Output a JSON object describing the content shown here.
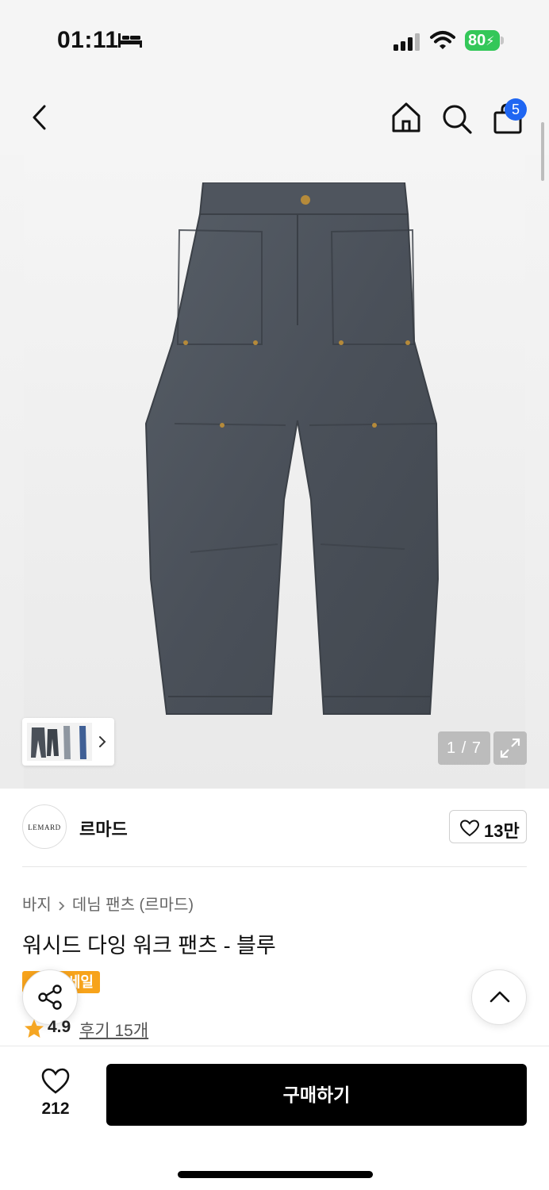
{
  "status_bar": {
    "time": "01:11",
    "battery": "80",
    "icons": [
      "bed-icon",
      "signal-icon",
      "wifi-icon",
      "battery-charging-icon"
    ]
  },
  "nav": {
    "icons": [
      "back-icon",
      "home-icon",
      "search-icon",
      "shopping-bag-icon"
    ],
    "cart_count": "5"
  },
  "gallery": {
    "counter": "1 / 7",
    "icons": [
      "chevron-right-icon",
      "expand-icon"
    ],
    "photo_bg": "#ececec",
    "pants_color": "#4a5059"
  },
  "brand": {
    "logo_text": "LEMARD",
    "name": "르마드",
    "like_count": "13만"
  },
  "product": {
    "breadcrumb": [
      "바지",
      "데님 팬츠 (르마드)"
    ],
    "title": "워시드 다잉 워크 팬츠 - 블루",
    "badge": "세일",
    "rating": "4.9",
    "review_link": "후기 15개"
  },
  "bottom_bar": {
    "wish_count": "212",
    "buy_label": "구매하기"
  },
  "colors": {
    "accent_blue": "#1f66f2",
    "badge_orange": "#f7a31b",
    "battery_green": "#34c759",
    "star": "#f5a623",
    "buy_button": "#000000"
  }
}
